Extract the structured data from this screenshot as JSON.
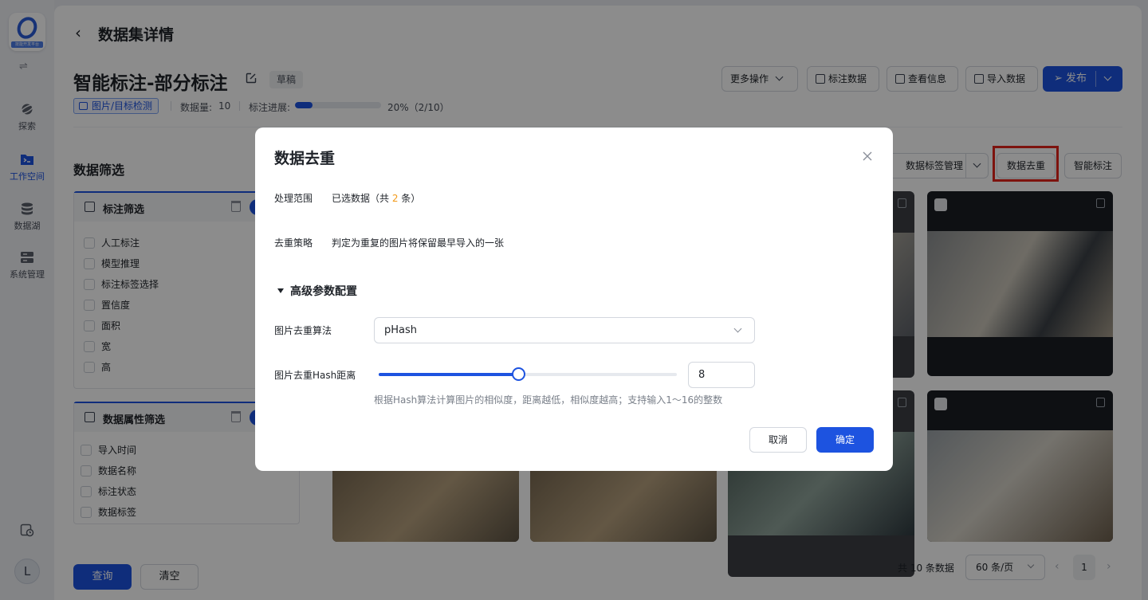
{
  "rail": {
    "logo_text": "技能开发平台",
    "items": [
      {
        "label": "探索",
        "icon": "planet-icon"
      },
      {
        "label": "工作空间",
        "icon": "terminal-folder-icon",
        "active": true
      },
      {
        "label": "数据湖",
        "icon": "database-icon"
      },
      {
        "label": "系统管理",
        "icon": "server-icon"
      }
    ],
    "avatar_letter": "L"
  },
  "header": {
    "page_title": "数据集详情",
    "dataset_name": "智能标注-部分标注",
    "status_badge": "草稿",
    "type_tag": "图片/目标检测",
    "count_label": "数据量:",
    "count_value": "10",
    "progress_label": "标注进展:",
    "progress_fraction": 0.2,
    "progress_text": "20%（2/10）",
    "buttons": {
      "more_actions": "更多操作",
      "annotate_data": "标注数据",
      "view_info": "查看信息",
      "import_data": "导入数据",
      "publish": "发布"
    }
  },
  "filter": {
    "title": "数据筛选",
    "annotation_group": {
      "title": "标注筛选",
      "options": [
        "人工标注",
        "模型推理",
        "标注标签选择",
        "置信度",
        "面积",
        "宽",
        "高"
      ]
    },
    "attribute_group": {
      "title": "数据属性筛选",
      "options": [
        "导入时间",
        "数据名称",
        "标注状态",
        "数据标签"
      ]
    },
    "query_button": "查询",
    "clear_button": "清空"
  },
  "toolbar": {
    "tag_management": "数据标签管理",
    "dedup": "数据去重",
    "smart_annotate": "智能标注"
  },
  "pagination": {
    "total_text": "共 10 条数据",
    "page_size": "60 条/页",
    "current_page": "1"
  },
  "modal": {
    "title": "数据去重",
    "scope_label": "处理范围",
    "scope_prefix": "已选数据（共 ",
    "scope_count": "2",
    "scope_suffix": " 条）",
    "strategy_label": "去重策略",
    "strategy_value": "判定为重复的图片将保留最早导入的一张",
    "advanced_section": "高级参数配置",
    "algorithm_label": "图片去重算法",
    "algorithm_value": "pHash",
    "distance_label": "图片去重Hash距离",
    "distance_value": "8",
    "distance_min": 1,
    "distance_max": 16,
    "hint": "根据Hash算法计算图片的相似度，距离越低，相似度越高；支持输入1～16的整数",
    "cancel": "取消",
    "confirm": "确定"
  },
  "colors": {
    "primary": "#1d53e0",
    "highlight": "#f29a1a",
    "dedup_outline": "#e3241b"
  }
}
